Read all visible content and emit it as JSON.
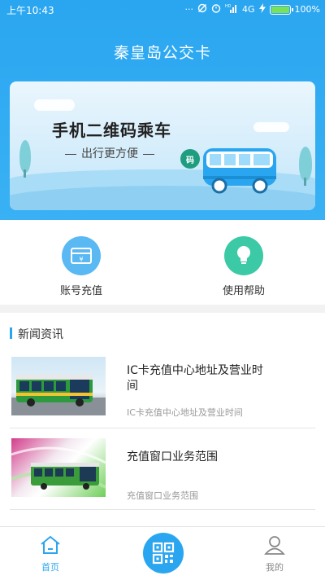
{
  "status_bar": {
    "time": "上午10:43",
    "network": "4G",
    "battery": "100%",
    "dots": "···",
    "hd": "HD"
  },
  "header": {
    "title": "秦皇岛公交卡"
  },
  "banner": {
    "title": "手机二维码乘车",
    "subtitle": "出行更方便",
    "badge_text": "码"
  },
  "actions": [
    {
      "label": "账号充值",
      "icon": "wallet-card-icon",
      "color": "#5ab8f3"
    },
    {
      "label": "使用帮助",
      "icon": "lightbulb-icon",
      "color": "#3cc9a6"
    }
  ],
  "news": {
    "header": "新闻资讯",
    "items": [
      {
        "title": "IC卡充值中心地址及营业时间",
        "desc": "IC卡充值中心地址及营业时间"
      },
      {
        "title": "充值窗口业务范围",
        "desc": "充值窗口业务范围"
      }
    ]
  },
  "tabbar": {
    "home_label": "首页",
    "mine_label": "我的",
    "active_color": "#2aa6f0",
    "inactive_color": "#888888"
  }
}
